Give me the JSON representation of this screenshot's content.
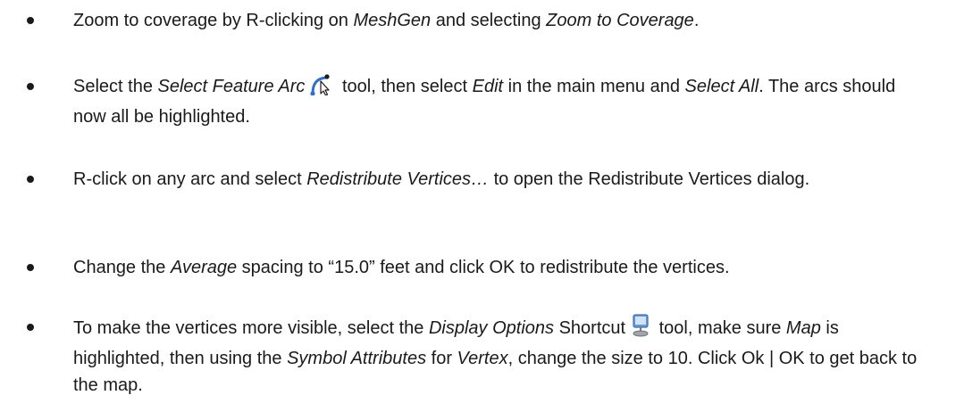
{
  "bullets": [
    {
      "parts": [
        "Zoom to coverage by R-clicking on ",
        "MeshGen",
        " and selecting ",
        "Zoom to Coverage",
        "."
      ]
    },
    {
      "parts": [
        "Select the ",
        "Select Feature Arc",
        " tool, then select ",
        "Edit",
        " in the main menu and ",
        "Select All",
        ". The arcs should now all be highlighted."
      ],
      "icon": "select-feature-arc-icon"
    },
    {
      "parts": [
        "R-click on any arc and select ",
        "Redistribute Vertices…",
        " to open the Redistribute Vertices dialog."
      ]
    },
    {
      "parts": [
        "Change the ",
        "Average",
        " spacing to “15.0” feet and click OK to redistribute the vertices."
      ]
    },
    {
      "parts": [
        "To make the vertices more visible, select the ",
        "Display Options",
        " Shortcut",
        " tool, make sure ",
        "Map",
        " is highlighted, then using the ",
        "Symbol Attributes",
        " for ",
        "Vertex",
        ", change the size to 10. Click Ok | OK to get back to the map."
      ],
      "icon": "display-options-icon"
    }
  ]
}
